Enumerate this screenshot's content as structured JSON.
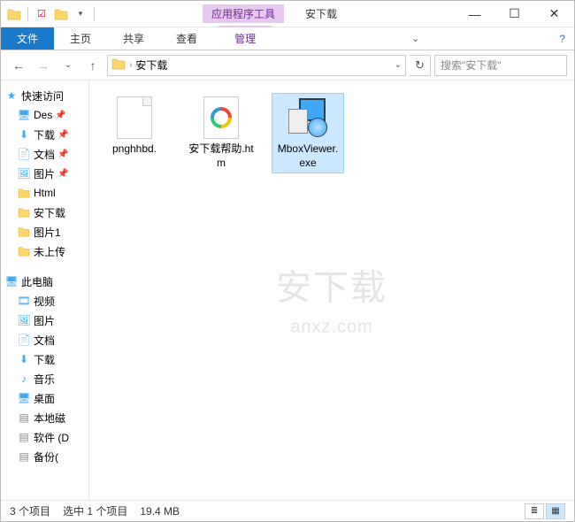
{
  "titlebar": {
    "contextual_label": "应用程序工具",
    "window_title": "安下载"
  },
  "win_controls": {
    "min": "—",
    "max": "☐",
    "close": "✕"
  },
  "ribbon": {
    "file": "文件",
    "tabs": [
      "主页",
      "共享",
      "查看"
    ],
    "contextual": "管理"
  },
  "addressbar": {
    "path": "安下载",
    "search_placeholder": "搜索\"安下载\""
  },
  "sidebar": {
    "quick_access": "快速访问",
    "quick_items": [
      {
        "label": "Des",
        "icon": "desktop",
        "pinned": true
      },
      {
        "label": "下载",
        "icon": "download",
        "pinned": true
      },
      {
        "label": "文档",
        "icon": "document",
        "pinned": true
      },
      {
        "label": "图片",
        "icon": "picture",
        "pinned": true
      },
      {
        "label": "Html",
        "icon": "folder",
        "pinned": false
      },
      {
        "label": "安下载",
        "icon": "folder",
        "pinned": false
      },
      {
        "label": "图片1",
        "icon": "folder",
        "pinned": false
      },
      {
        "label": "未上传",
        "icon": "folder",
        "pinned": false
      }
    ],
    "this_pc": "此电脑",
    "pc_items": [
      {
        "label": "视频",
        "icon": "video"
      },
      {
        "label": "图片",
        "icon": "picture"
      },
      {
        "label": "文档",
        "icon": "document"
      },
      {
        "label": "下载",
        "icon": "download"
      },
      {
        "label": "音乐",
        "icon": "music"
      },
      {
        "label": "桌面",
        "icon": "desktop"
      },
      {
        "label": "本地磁",
        "icon": "disk"
      },
      {
        "label": "软件 (D",
        "icon": "disk"
      },
      {
        "label": "备份(",
        "icon": "disk"
      }
    ]
  },
  "files": [
    {
      "name": "pnghhbd.",
      "type": "blank"
    },
    {
      "name": "安下载帮助.htm",
      "type": "htm"
    },
    {
      "name": "MboxViewer.exe",
      "type": "exe",
      "selected": true
    }
  ],
  "statusbar": {
    "count": "3 个项目",
    "selection": "选中 1 个项目",
    "size": "19.4 MB"
  },
  "watermark": {
    "main": "安下载",
    "sub": "anxz.com"
  }
}
